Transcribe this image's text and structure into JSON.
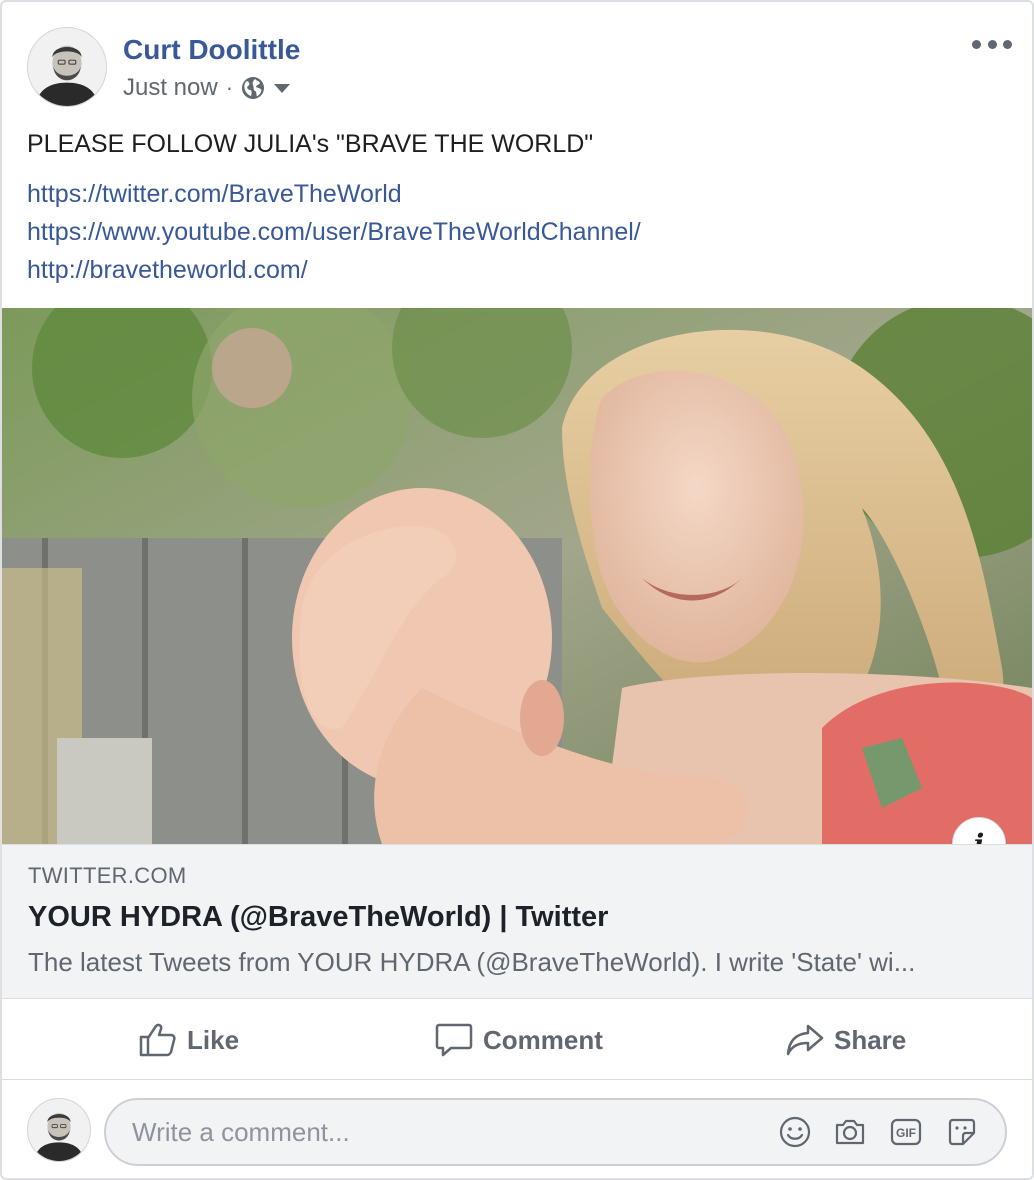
{
  "post": {
    "author_name": "Curt Doolittle",
    "timestamp": "Just now",
    "separator": "·",
    "privacy_icon": "globe-icon",
    "text": "PLEASE FOLLOW JULIA's \"BRAVE THE WORLD\"",
    "links": [
      "https://twitter.com/BraveTheWorld",
      "https://www.youtube.com/user/BraveTheWorldChannel/",
      "http://bravetheworld.com/"
    ]
  },
  "link_preview": {
    "domain": "TWITTER.COM",
    "title": "YOUR HYDRA (@BraveTheWorld) | Twitter",
    "description": "The latest Tweets from YOUR HYDRA (@BraveTheWorld). I write 'State' wi...",
    "info_label": "i"
  },
  "actions": {
    "like": "Like",
    "comment": "Comment",
    "share": "Share"
  },
  "composer": {
    "placeholder": "Write a comment...",
    "icons": [
      "emoji-icon",
      "camera-icon",
      "gif-icon",
      "sticker-icon"
    ],
    "gif_label": "GIF"
  },
  "colors": {
    "link_blue": "#385898",
    "secondary_text": "#606770",
    "panel_gray": "#f2f3f5"
  }
}
